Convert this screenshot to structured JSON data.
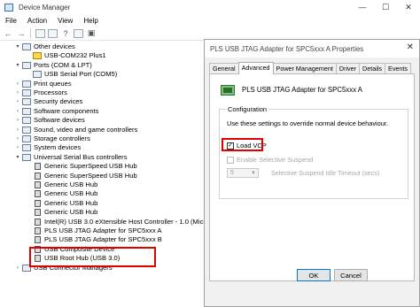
{
  "dm": {
    "title": "Device Manager",
    "menu": [
      "File",
      "Action",
      "View",
      "Help"
    ],
    "tree": [
      {
        "label": "Other devices",
        "expander": "▾",
        "indent": 0,
        "icon": "folder-icon"
      },
      {
        "label": "USB-COM232 Plus1",
        "expander": "",
        "indent": 1,
        "icon": "warning-device-icon"
      },
      {
        "label": "Ports (COM & LPT)",
        "expander": "▾",
        "indent": 0,
        "icon": "port-icon"
      },
      {
        "label": "USB Serial Port (COM5)",
        "expander": "",
        "indent": 1,
        "icon": "port-icon"
      },
      {
        "label": "Print queues",
        "expander": "›",
        "indent": 0,
        "icon": "printer-icon"
      },
      {
        "label": "Processors",
        "expander": "›",
        "indent": 0,
        "icon": "processor-icon"
      },
      {
        "label": "Security devices",
        "expander": "›",
        "indent": 0,
        "icon": "security-icon"
      },
      {
        "label": "Software components",
        "expander": "›",
        "indent": 0,
        "icon": "component-icon"
      },
      {
        "label": "Software devices",
        "expander": "›",
        "indent": 0,
        "icon": "component-icon"
      },
      {
        "label": "Sound, video and game controllers",
        "expander": "›",
        "indent": 0,
        "icon": "sound-icon"
      },
      {
        "label": "Storage controllers",
        "expander": "›",
        "indent": 0,
        "icon": "storage-icon"
      },
      {
        "label": "System devices",
        "expander": "›",
        "indent": 0,
        "icon": "system-icon"
      },
      {
        "label": "Universal Serial Bus controllers",
        "expander": "▾",
        "indent": 0,
        "icon": "usb-icon"
      },
      {
        "label": "Generic SuperSpeed USB Hub",
        "expander": "",
        "indent": 1,
        "icon": "usb-icon"
      },
      {
        "label": "Generic SuperSpeed USB Hub",
        "expander": "",
        "indent": 1,
        "icon": "usb-icon"
      },
      {
        "label": "Generic USB Hub",
        "expander": "",
        "indent": 1,
        "icon": "usb-icon"
      },
      {
        "label": "Generic USB Hub",
        "expander": "",
        "indent": 1,
        "icon": "usb-icon"
      },
      {
        "label": "Generic USB Hub",
        "expander": "",
        "indent": 1,
        "icon": "usb-icon"
      },
      {
        "label": "Generic USB Hub",
        "expander": "",
        "indent": 1,
        "icon": "usb-icon"
      },
      {
        "label": "Intel(R) USB 3.0 eXtensible Host Controller - 1.0 (Microsoft)",
        "expander": "",
        "indent": 1,
        "icon": "usb-icon"
      },
      {
        "label": "PLS USB JTAG Adapter for SPC5xxx A",
        "expander": "",
        "indent": 1,
        "icon": "usb-icon"
      },
      {
        "label": "PLS USB JTAG Adapter for SPC5xxx B",
        "expander": "",
        "indent": 1,
        "icon": "usb-icon"
      },
      {
        "label": "USB Composite Device",
        "expander": "",
        "indent": 1,
        "icon": "usb-icon"
      },
      {
        "label": "USB Root Hub (USB 3.0)",
        "expander": "",
        "indent": 1,
        "icon": "usb-icon"
      },
      {
        "label": "USB Connector Managers",
        "expander": "›",
        "indent": 0,
        "icon": "usb-icon"
      }
    ]
  },
  "dialog": {
    "title": "PLS USB JTAG Adapter for SPC5xxx A Properties",
    "tabs": [
      "General",
      "Advanced",
      "Power Management",
      "Driver",
      "Details",
      "Events"
    ],
    "active_tab": "Advanced",
    "device_name": "PLS USB JTAG Adapter for SPC5xxx A",
    "group_label": "Configuration",
    "description": "Use these settings to override normal device behaviour.",
    "load_vcp": {
      "label": "Load VCP",
      "checked": true,
      "mark": "✓"
    },
    "selective_suspend": {
      "label": "Enable Selective Suspend",
      "checked": false,
      "disabled": true
    },
    "timeout_value": "5",
    "timeout_label": "Selective Suspend Idle Timeout (secs)",
    "ok": "OK",
    "cancel": "Cancel"
  },
  "colors": {
    "highlight": "#e00000",
    "default_button_border": "#0078d7"
  }
}
